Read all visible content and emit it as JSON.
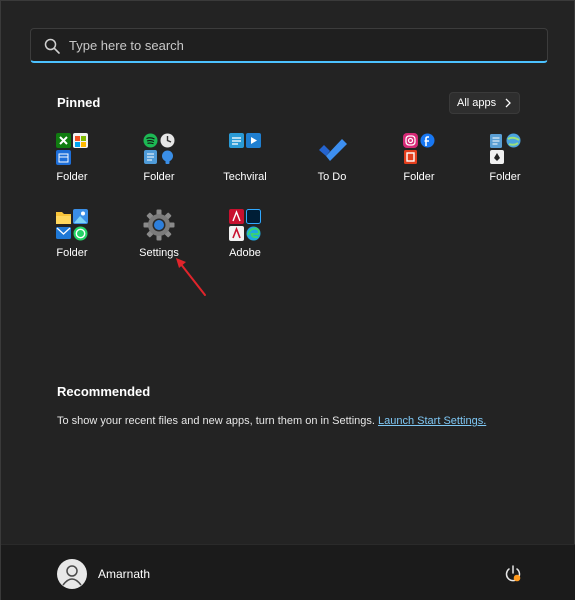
{
  "search": {
    "placeholder": "Type here to search"
  },
  "pinned": {
    "title": "Pinned",
    "all_apps_label": "All apps",
    "tiles": [
      {
        "label": "Folder",
        "icon": "folder-xbox-store-calendar"
      },
      {
        "label": "Folder",
        "icon": "folder-spotify-clock-notes-tips"
      },
      {
        "label": "Techviral",
        "icon": "techviral-icon"
      },
      {
        "label": "To Do",
        "icon": "todo-checkmark-icon"
      },
      {
        "label": "Folder",
        "icon": "folder-instagram-facebook-office"
      },
      {
        "label": "Folder",
        "icon": "folder-notepad-globe-solitaire"
      },
      {
        "label": "Folder",
        "icon": "folder-explorer-photos-mail-whatsapp"
      },
      {
        "label": "Settings",
        "icon": "gear-icon"
      },
      {
        "label": "Adobe",
        "icon": "folder-adobe-edge"
      }
    ]
  },
  "recommended": {
    "title": "Recommended",
    "text": "To show your recent files and new apps, turn them on in Settings. ",
    "link": "Launch Start Settings."
  },
  "user": {
    "name": "Amarnath"
  },
  "colors": {
    "accent": "#4cc2ff",
    "link": "#7fc8f5",
    "annotation": "#e0242b"
  }
}
